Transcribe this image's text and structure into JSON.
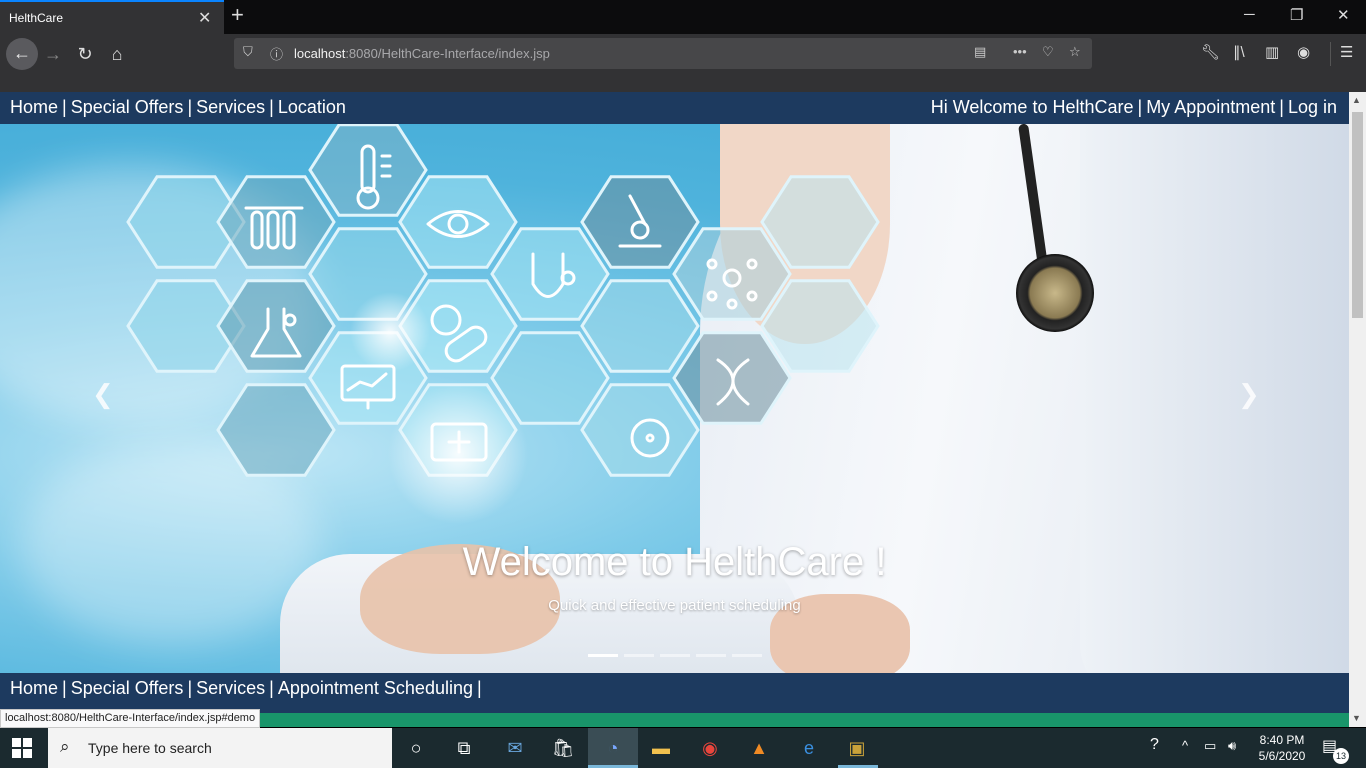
{
  "browser": {
    "tab_title": "HelthCare",
    "url_host": "localhost",
    "url_path": ":8080/HelthCare-Interface/index.jsp",
    "status_url": "localhost:8080/HelthCare-Interface/index.jsp#demo"
  },
  "topnav": {
    "left": [
      "Home",
      "Special Offers",
      "Services",
      "Location"
    ],
    "right": [
      "Hi Welcome to HelthCare",
      "My Appointment",
      "Log in"
    ]
  },
  "carousel": {
    "title": "Welcome to HelthCare !",
    "subtitle": "Quick and effective patient scheduling",
    "slide_count": 5,
    "active_slide": 1
  },
  "bottomnav": {
    "items": [
      "Home",
      "Special Offers",
      "Services",
      "Appointment Scheduling"
    ]
  },
  "taskbar": {
    "search_placeholder": "Type here to search",
    "time": "8:40 PM",
    "date": "5/6/2020",
    "notifications": "13"
  }
}
